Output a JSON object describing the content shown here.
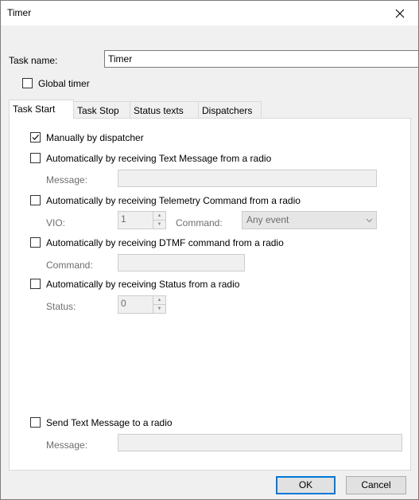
{
  "window": {
    "title": "Timer"
  },
  "task_name": {
    "label": "Task name:",
    "value": "Timer"
  },
  "global_timer": {
    "label": "Global timer",
    "checked": false
  },
  "tabs": [
    {
      "label": "Task Start",
      "active": true
    },
    {
      "label": "Task Stop",
      "active": false
    },
    {
      "label": "Status texts",
      "active": false
    },
    {
      "label": "Dispatchers",
      "active": false
    }
  ],
  "task_start": {
    "manual": {
      "label": "Manually by dispatcher",
      "checked": true
    },
    "text_message": {
      "label": "Automatically by receiving Text Message from a radio",
      "checked": false,
      "message_label": "Message:",
      "message_value": ""
    },
    "telemetry": {
      "label": "Automatically by receiving Telemetry Command from a radio",
      "checked": false,
      "vio_label": "VIO:",
      "vio_value": "1",
      "command_label": "Command:",
      "command_value": "Any event"
    },
    "dtmf": {
      "label": "Automatically by receiving DTMF command from a radio",
      "checked": false,
      "command_label": "Command:",
      "command_value": ""
    },
    "status": {
      "label": "Automatically by receiving Status from a radio",
      "checked": false,
      "status_label": "Status:",
      "status_value": "0"
    },
    "send_text": {
      "label": "Send Text Message to a radio",
      "checked": false,
      "message_label": "Message:",
      "message_value": ""
    }
  },
  "buttons": {
    "ok": "OK",
    "cancel": "Cancel"
  },
  "icons": {
    "close": "close-icon",
    "check": "checkmark-icon",
    "spin_up": "spin-up-icon",
    "spin_down": "spin-down-icon",
    "dropdown": "chevron-down-icon"
  }
}
